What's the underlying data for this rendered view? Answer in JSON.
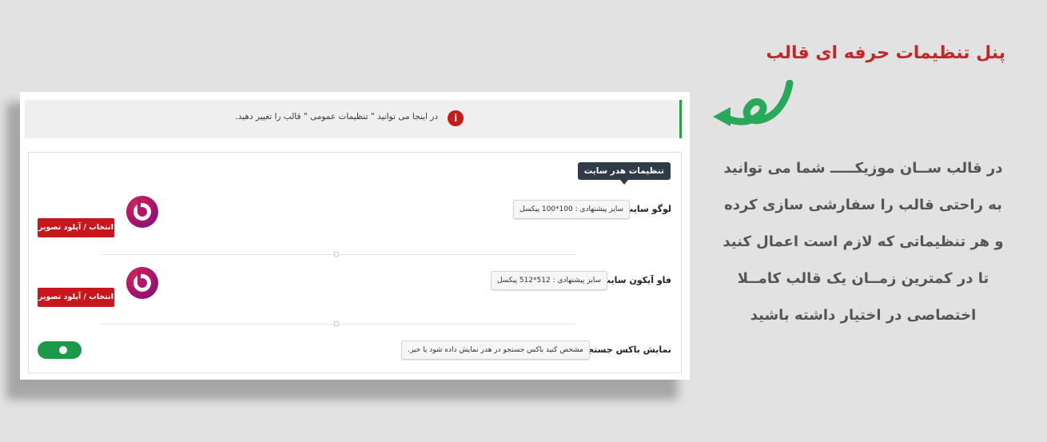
{
  "notice": {
    "text": "در اینجا می توانید \" تنظیمات عمومی \" قالب را تغییر دهید.",
    "icon": "info-icon",
    "icon_glyph": "i"
  },
  "section": {
    "title": "تنظیمات هدر سایت"
  },
  "rows": {
    "logo": {
      "label": "لوگو سایت :",
      "hint": "سایز پیشنهادی : 100*100 پیکسل",
      "button": "انتخاب / آپلود تصویر"
    },
    "favicon": {
      "label": "فاو آیکون سایت :",
      "hint": "سایز پیشنهادی : 512*512 پیکسل",
      "button": "انتخاب / آپلود تصویر"
    },
    "search": {
      "label": "نمایش باکس جستجو :",
      "hint": "مشخص کنید باکس جستجو در هدر نمایش داده شود یا خیر.",
      "toggle_on": true
    }
  },
  "promo": {
    "title": "پنل تنظیمات حرفه ای قالب",
    "lines": [
      "در قالب ســان موزیکـــــ شما می توانید",
      "به راحتی  قالب  را سفارشی سازی کرده",
      "و هر تنظیماتی که لازم است اعمال کنید",
      "تا  در کمترین زمــان یک  قالب کامــلا",
      "اختصاصی در اختیار داشته باشید"
    ]
  },
  "colors": {
    "accent_red": "#c8161d",
    "title_red": "#c0282a",
    "toggle_green": "#1d9a47",
    "notice_bar_green": "#27a146",
    "badge_dark": "#2f3b46",
    "arrow_green": "#2aa85a"
  }
}
